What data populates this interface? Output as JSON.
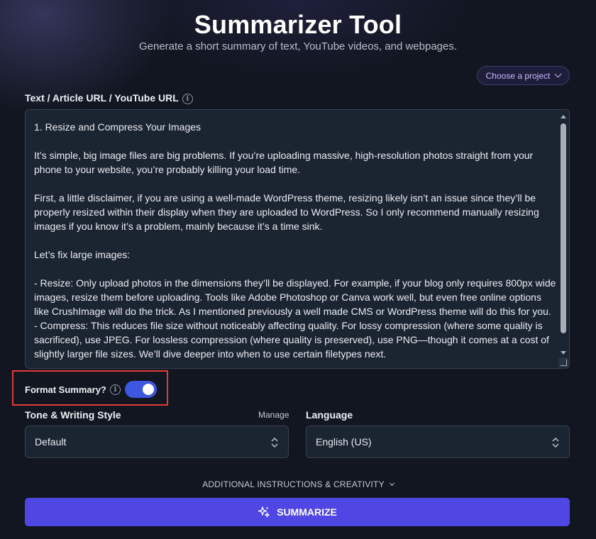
{
  "header": {
    "title": "Summarizer Tool",
    "subtitle": "Generate a short summary of text, YouTube videos, and webpages."
  },
  "project_selector": {
    "label": "Choose a project"
  },
  "input": {
    "label": "Text / Article URL / YouTube URL",
    "paragraphs": [
      "1. Resize and Compress Your Images",
      "It’s simple, big image files are big problems. If you’re uploading massive, high-resolution photos straight from your phone to your website, you’re probably killing your load time.",
      "First, a little disclaimer, if you are using a well-made WordPress theme, resizing likely isn’t an issue since they’ll be properly resized within their display when they are uploaded to WordPress. So I only recommend manually resizing images if you know it’s a problem, mainly because it’s a time sink.",
      "Let’s fix large images:",
      "- Resize: Only upload photos in the dimensions they’ll be displayed. For example, if your blog only requires 800px wide images, resize them before uploading. Tools like Adobe Photoshop or Canva work well, but even free online options like CrushImage will do the trick. As I mentioned previously a well made CMS or WordPress theme will do this for you.",
      "- Compress: This reduces file size without noticeably affecting quality. For lossy compression (where some quality is sacrificed), use JPEG. For lossless compression (where quality is preserved), use PNG—though it comes at a cost of slightly larger file sizes. We’ll dive deeper into when to use certain filetypes next."
    ]
  },
  "format_summary": {
    "label": "Format Summary?",
    "enabled": true
  },
  "tone": {
    "label": "Tone & Writing Style",
    "manage_label": "Manage",
    "value": "Default"
  },
  "language": {
    "label": "Language",
    "value": "English (US)"
  },
  "additional": {
    "label": "ADDITIONAL INSTRUCTIONS & CREATIVITY"
  },
  "action": {
    "summarize_label": "SUMMARIZE"
  },
  "colors": {
    "background": "#121620",
    "accent": "#5046e4",
    "toggle": "#3e57e0",
    "highlight": "#e23b3b",
    "project_text": "#c9b8ff"
  }
}
